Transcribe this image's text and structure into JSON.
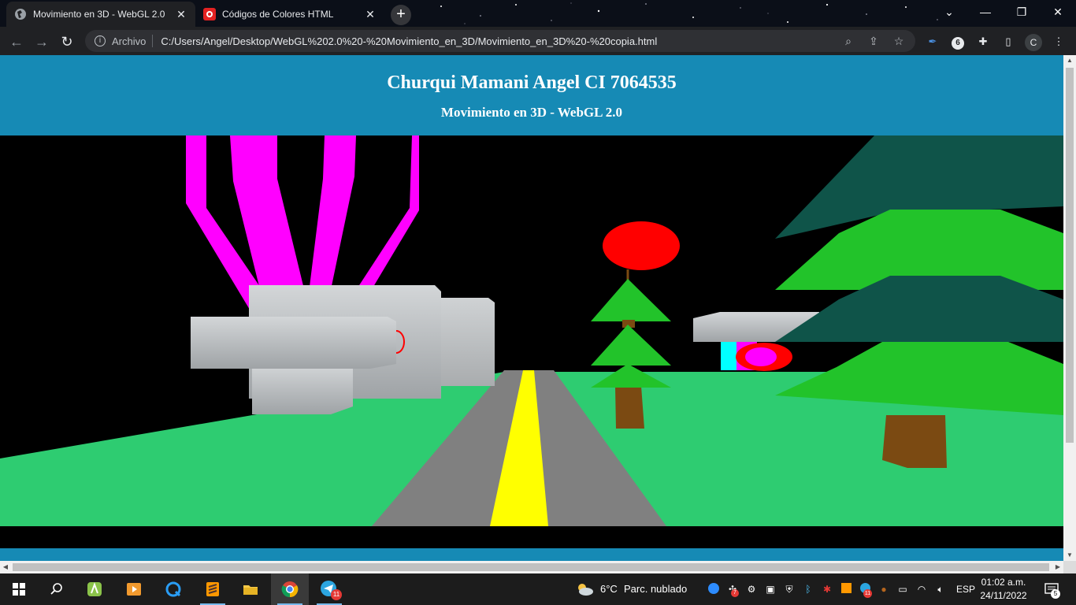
{
  "browser": {
    "tabs": [
      {
        "title": "Movimiento en 3D - WebGL 2.0",
        "active": true
      },
      {
        "title": "Códigos de Colores HTML",
        "active": false
      }
    ],
    "address": {
      "scheme_label": "Archivo",
      "url": "C:/Users/Angel/Desktop/WebGL%202.0%20-%20Movimiento_en_3D/Movimiento_en_3D%20-%20copia.html"
    },
    "profile_initial": "C",
    "extension_badge": "6"
  },
  "page": {
    "title": "Churqui Mamani Angel CI 7064535",
    "subtitle": "Movimiento en 3D - WebGL 2.0",
    "colors": {
      "header": "#168ab5",
      "grass": "#2ecc71",
      "road": "#808080",
      "road_line": "#ffff00",
      "magenta": "#ff00ff",
      "tree_green": "#22c32a",
      "tree_dark": "#0f5449",
      "trunk": "#7b4a12",
      "red": "#ff0000",
      "cyan": "#00ffff"
    }
  },
  "taskbar": {
    "weather_temp": "6°C",
    "weather_text": "Parc. nublado",
    "language": "ESP",
    "time": "01:02 a.m.",
    "date": "24/11/2022",
    "notifications": "5",
    "telegram_badge": "11",
    "tray_badge_7": "7",
    "tray_badge_11": "11"
  }
}
